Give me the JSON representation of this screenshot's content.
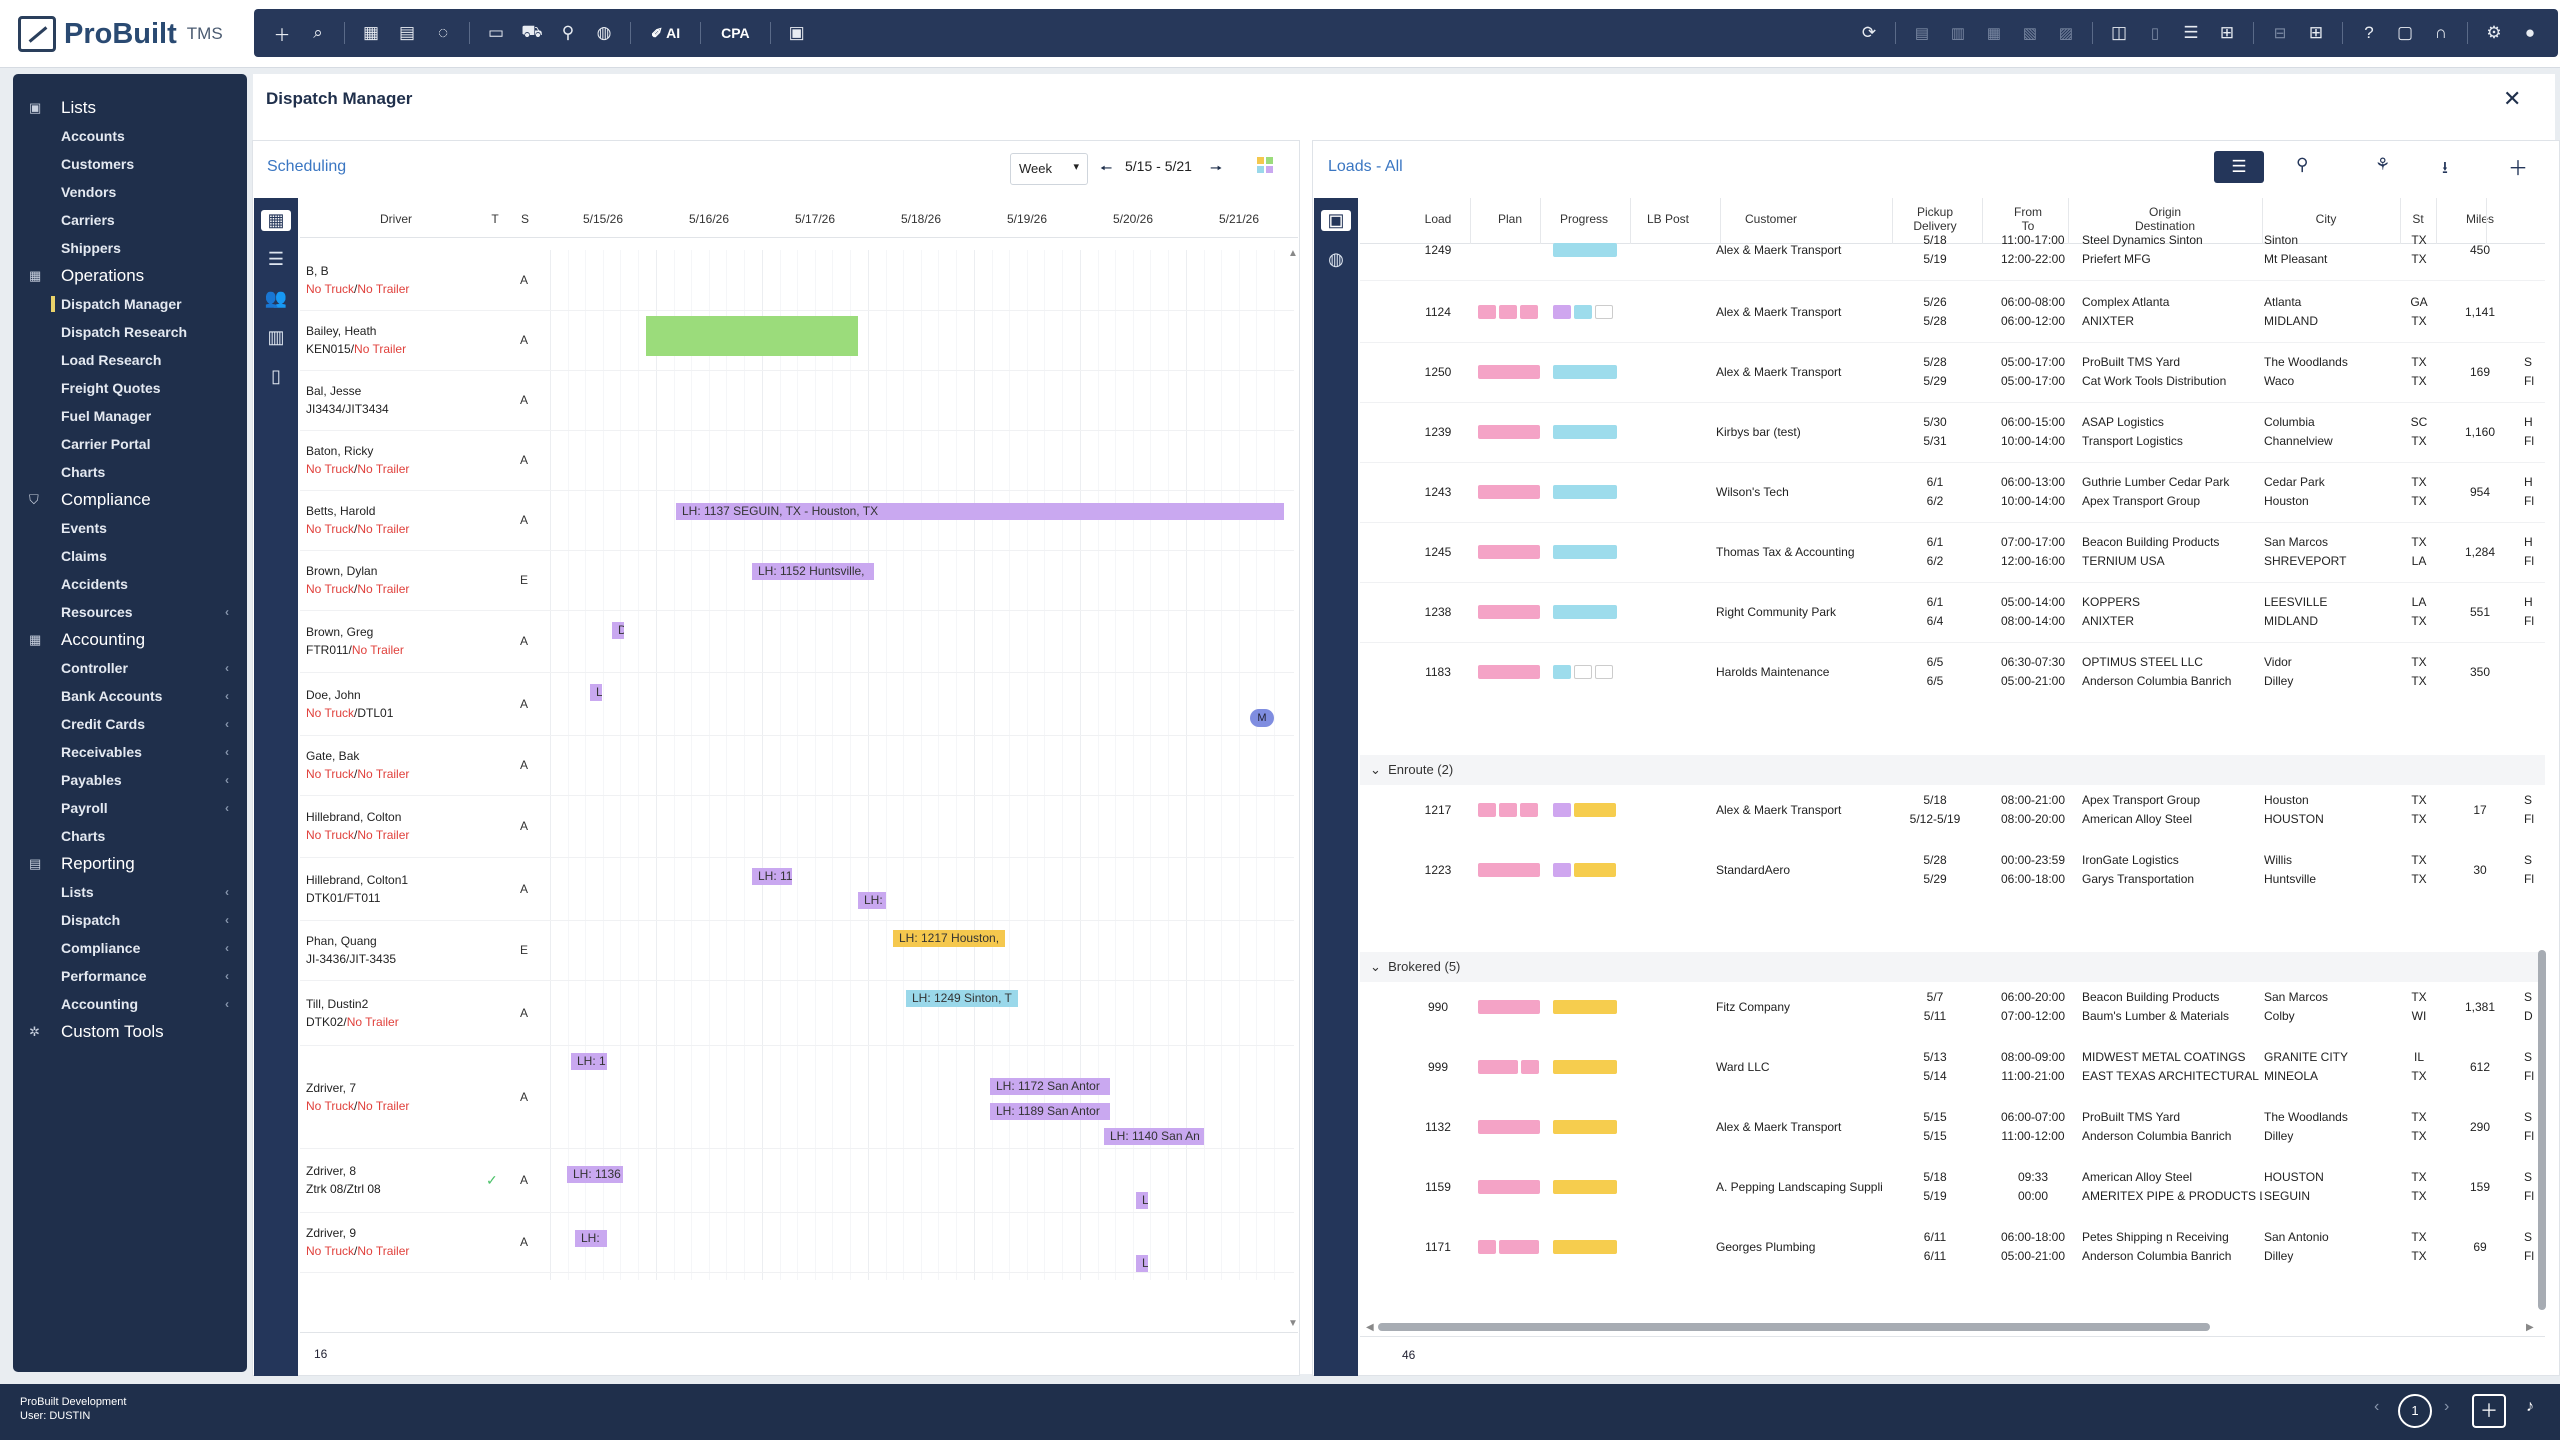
{
  "app": {
    "name": "ProBuilt",
    "suffix": "TMS"
  },
  "toolbar": {
    "ai": "AI",
    "cpa": "CPA"
  },
  "sidebar": {
    "sections": [
      {
        "label": "Lists",
        "items": [
          {
            "label": "Accounts"
          },
          {
            "label": "Customers"
          },
          {
            "label": "Vendors"
          },
          {
            "label": "Carriers"
          },
          {
            "label": "Shippers"
          }
        ]
      },
      {
        "label": "Operations",
        "items": [
          {
            "label": "Dispatch Manager",
            "active": true
          },
          {
            "label": "Dispatch Research"
          },
          {
            "label": "Load Research"
          },
          {
            "label": "Freight Quotes"
          },
          {
            "label": "Fuel Manager"
          },
          {
            "label": "Carrier Portal"
          },
          {
            "label": "Charts"
          }
        ]
      },
      {
        "label": "Compliance",
        "items": [
          {
            "label": "Events"
          },
          {
            "label": "Claims"
          },
          {
            "label": "Accidents"
          },
          {
            "label": "Resources"
          }
        ]
      },
      {
        "label": "Accounting",
        "items": [
          {
            "label": "Controller"
          },
          {
            "label": "Bank Accounts"
          },
          {
            "label": "Credit Cards"
          },
          {
            "label": "Receivables"
          },
          {
            "label": "Payables"
          },
          {
            "label": "Payroll"
          },
          {
            "label": "Charts"
          }
        ]
      },
      {
        "label": "Reporting",
        "items": [
          {
            "label": "Lists"
          },
          {
            "label": "Dispatch"
          },
          {
            "label": "Compliance"
          },
          {
            "label": "Performance"
          },
          {
            "label": "Accounting"
          }
        ]
      },
      {
        "label": "Custom Tools",
        "items": []
      }
    ]
  },
  "page": {
    "title": "Dispatch Manager"
  },
  "scheduling": {
    "title": "Scheduling",
    "view": "Week",
    "range": "5/15 - 5/21",
    "headers": {
      "driver": "Driver",
      "t": "T",
      "s": "S"
    },
    "dates": [
      "5/15/26",
      "5/16/26",
      "5/17/26",
      "5/18/26",
      "5/19/26",
      "5/20/26",
      "5/21/26"
    ],
    "drivers": [
      {
        "name": "B, B",
        "l2a": "No Truck",
        "l2b": "No Trailer",
        "s": "A"
      },
      {
        "name": "Bailey, Heath",
        "l2a": "KEN015",
        "l2b": "No Trailer",
        "s": "A"
      },
      {
        "name": "Bal, Jesse",
        "l2a": "JI3434/JIT3434",
        "l2b": "",
        "s": "A"
      },
      {
        "name": "Baton, Ricky",
        "l2a": "No Truck",
        "l2b": "No Trailer",
        "s": "A"
      },
      {
        "name": "Betts, Harold",
        "l2a": "No Truck",
        "l2b": "No Trailer",
        "s": "A"
      },
      {
        "name": "Brown, Dylan",
        "l2a": "No Truck",
        "l2b": "No Trailer",
        "s": "E"
      },
      {
        "name": "Brown, Greg",
        "l2a": "FTR011",
        "l2b": "No Trailer",
        "s": "A"
      },
      {
        "name": "Doe, John",
        "l2a": "No Truck",
        "l2b": "DTL01",
        "s": "A"
      },
      {
        "name": "Gate, Bak",
        "l2a": "No Truck",
        "l2b": "No Trailer",
        "s": "A"
      },
      {
        "name": "Hillebrand, Colton",
        "l2a": "No Truck",
        "l2b": "No Trailer",
        "s": "A"
      },
      {
        "name": "Hillebrand, Colton1",
        "l2a": "DTK01/FT011",
        "l2b": "",
        "s": "A"
      },
      {
        "name": "Phan, Quang",
        "l2a": "JI-3436/JIT-3435",
        "l2b": "",
        "s": "E"
      },
      {
        "name": "Till, Dustin2",
        "l2a": "DTK02",
        "l2b": "No Trailer",
        "s": "A"
      },
      {
        "name": "Zdriver, 7",
        "l2a": "No Truck",
        "l2b": "No Trailer",
        "s": "A"
      },
      {
        "name": "Zdriver, 8",
        "l2a": "Ztrk 08/Ztrl 08",
        "l2b": "",
        "s": "A"
      },
      {
        "name": "Zdriver, 9",
        "l2a": "No Truck",
        "l2b": "No Trailer",
        "s": "A"
      }
    ],
    "bars": {
      "b1": "LH: 1137  SEGUIN, TX - Houston, TX",
      "b2": "LH: 1152  Huntsville,",
      "b3": "LH: 11",
      "b4": "LH:",
      "b5": "LH: 1217  Houston,",
      "b6": "LH: 1249  Sinton, T",
      "b7": "LH: 1",
      "b8": "LH: 1172  San Antor",
      "b9": "LH: 1189  San Antor",
      "b10": "LH: 1140  San An",
      "b11": "LH: 1136",
      "b12": "LH:",
      "b13": "L",
      "b14": "L",
      "b15": "D",
      "b16": "L",
      "b17": "M"
    },
    "count": "16"
  },
  "loads": {
    "title": "Loads - All",
    "headers": {
      "load": "Load",
      "plan": "Plan",
      "progress": "Progress",
      "lbpost": "LB Post",
      "customer": "Customer",
      "pd1": "Pickup",
      "pd2": "Delivery",
      "ft1": "From",
      "ft2": "To",
      "od1": "Origin",
      "od2": "Destination",
      "city": "City",
      "st": "St",
      "miles": "Miles"
    },
    "rows": [
      {
        "load": "1249",
        "customer": "Alex & Maerk Transport",
        "d1": "5/18",
        "d2": "5/19",
        "t1": "11:00-17:00",
        "t2": "12:00-22:00",
        "o1": "Steel Dynamics Sinton",
        "o2": "Priefert MFG",
        "c1": "Sinton",
        "c2": "Mt Pleasant",
        "s1": "TX",
        "s2": "TX",
        "miles": "450",
        "x1": "",
        "x2": ""
      },
      {
        "load": "1124",
        "customer": "Alex & Maerk Transport",
        "d1": "5/26",
        "d2": "5/28",
        "t1": "06:00-08:00",
        "t2": "06:00-12:00",
        "o1": "Complex Atlanta",
        "o2": "ANIXTER",
        "c1": "Atlanta",
        "c2": "MIDLAND",
        "s1": "GA",
        "s2": "TX",
        "miles": "1,141",
        "x1": "",
        "x2": ""
      },
      {
        "load": "1250",
        "customer": "Alex & Maerk Transport",
        "d1": "5/28",
        "d2": "5/29",
        "t1": "05:00-17:00",
        "t2": "05:00-17:00",
        "o1": "ProBuilt TMS Yard",
        "o2": "Cat Work Tools Distribution",
        "c1": "The Woodlands",
        "c2": "Waco",
        "s1": "TX",
        "s2": "TX",
        "miles": "169",
        "x1": "S",
        "x2": "Fl"
      },
      {
        "load": "1239",
        "customer": "Kirbys bar (test)",
        "d1": "5/30",
        "d2": "5/31",
        "t1": "06:00-15:00",
        "t2": "10:00-14:00",
        "o1": "ASAP Logistics",
        "o2": "Transport Logistics",
        "c1": "Columbia",
        "c2": "Channelview",
        "s1": "SC",
        "s2": "TX",
        "miles": "1,160",
        "x1": "H",
        "x2": "Fl"
      },
      {
        "load": "1243",
        "customer": "Wilson's Tech",
        "d1": "6/1",
        "d2": "6/2",
        "t1": "06:00-13:00",
        "t2": "10:00-14:00",
        "o1": "Guthrie Lumber Cedar Park",
        "o2": "Apex Transport Group",
        "c1": "Cedar Park",
        "c2": "Houston",
        "s1": "TX",
        "s2": "TX",
        "miles": "954",
        "x1": "H",
        "x2": "Fl"
      },
      {
        "load": "1245",
        "customer": "Thomas Tax & Accounting",
        "d1": "6/1",
        "d2": "6/2",
        "t1": "07:00-17:00",
        "t2": "12:00-16:00",
        "o1": "Beacon Building Products",
        "o2": "TERNIUM USA",
        "c1": "San Marcos",
        "c2": "SHREVEPORT",
        "s1": "TX",
        "s2": "LA",
        "miles": "1,284",
        "x1": "H",
        "x2": "Fl"
      },
      {
        "load": "1238",
        "customer": "Right Community Park",
        "d1": "6/1",
        "d2": "6/4",
        "t1": "05:00-14:00",
        "t2": "08:00-14:00",
        "o1": "KOPPERS",
        "o2": "ANIXTER",
        "c1": "LEESVILLE",
        "c2": "MIDLAND",
        "s1": "LA",
        "s2": "TX",
        "miles": "551",
        "x1": "H",
        "x2": "Fl"
      },
      {
        "load": "1183",
        "customer": "Harolds Maintenance",
        "d1": "6/5",
        "d2": "6/5",
        "t1": "06:30-07:30",
        "t2": "05:00-21:00",
        "o1": "OPTIMUS STEEL LLC",
        "o2": "Anderson Columbia Banrich",
        "c1": "Vidor",
        "c2": "Dilley",
        "s1": "TX",
        "s2": "TX",
        "miles": "350",
        "x1": "",
        "x2": ""
      }
    ],
    "groups": {
      "enroute": "Enroute (2)",
      "brokered": "Brokered (5)"
    },
    "enroute": [
      {
        "load": "1217",
        "customer": "Alex & Maerk Transport",
        "d1": "5/18",
        "d2": "5/12-5/19",
        "t1": "08:00-21:00",
        "t2": "08:00-20:00",
        "o1": "Apex Transport Group",
        "o2": "American Alloy Steel",
        "c1": "Houston",
        "c2": "HOUSTON",
        "s1": "TX",
        "s2": "TX",
        "miles": "17",
        "x1": "S",
        "x2": "Fl"
      },
      {
        "load": "1223",
        "customer": "StandardAero",
        "d1": "5/28",
        "d2": "5/29",
        "t1": "00:00-23:59",
        "t2": "06:00-18:00",
        "o1": "IronGate Logistics",
        "o2": "Garys Transportation",
        "c1": "Willis",
        "c2": "Huntsville",
        "s1": "TX",
        "s2": "TX",
        "miles": "30",
        "x1": "S",
        "x2": "Fl"
      }
    ],
    "brokered": [
      {
        "load": "990",
        "customer": "Fitz Company",
        "d1": "5/7",
        "d2": "5/11",
        "t1": "06:00-20:00",
        "t2": "07:00-12:00",
        "o1": "Beacon Building Products",
        "o2": "Baum's Lumber & Materials",
        "c1": "San Marcos",
        "c2": "Colby",
        "s1": "TX",
        "s2": "WI",
        "miles": "1,381",
        "x1": "S",
        "x2": "D"
      },
      {
        "load": "999",
        "customer": "Ward LLC",
        "d1": "5/13",
        "d2": "5/14",
        "t1": "08:00-09:00",
        "t2": "11:00-21:00",
        "o1": "MIDWEST METAL COATINGS",
        "o2": "EAST TEXAS ARCHITECTURAL",
        "c1": "GRANITE CITY",
        "c2": "MINEOLA",
        "s1": "IL",
        "s2": "TX",
        "miles": "612",
        "x1": "S",
        "x2": "Fl"
      },
      {
        "load": "1132",
        "customer": "Alex & Maerk Transport",
        "d1": "5/15",
        "d2": "5/15",
        "t1": "06:00-07:00",
        "t2": "11:00-12:00",
        "o1": "ProBuilt TMS Yard",
        "o2": "Anderson Columbia Banrich",
        "c1": "The Woodlands",
        "c2": "Dilley",
        "s1": "TX",
        "s2": "TX",
        "miles": "290",
        "x1": "S",
        "x2": "Fl"
      },
      {
        "load": "1159",
        "customer": "A. Pepping Landscaping Suppli",
        "d1": "5/18",
        "d2": "5/19",
        "t1": "09:33",
        "t2": "00:00",
        "o1": "American Alloy Steel",
        "o2": "AMERITEX PIPE & PRODUCTS L",
        "c1": "HOUSTON",
        "c2": "SEGUIN",
        "s1": "TX",
        "s2": "TX",
        "miles": "159",
        "x1": "S",
        "x2": "Fl"
      },
      {
        "load": "1171",
        "customer": "Georges Plumbing",
        "d1": "6/11",
        "d2": "6/11",
        "t1": "06:00-18:00",
        "t2": "05:00-21:00",
        "o1": "Petes Shipping n Receiving",
        "o2": "Anderson Columbia Banrich",
        "c1": "San Antonio",
        "c2": "Dilley",
        "s1": "TX",
        "s2": "TX",
        "miles": "69",
        "x1": "S",
        "x2": "Fl"
      }
    ],
    "count": "46"
  },
  "footer": {
    "line1": "ProBuilt Development",
    "line2": "User: DUSTIN",
    "page": "1"
  }
}
